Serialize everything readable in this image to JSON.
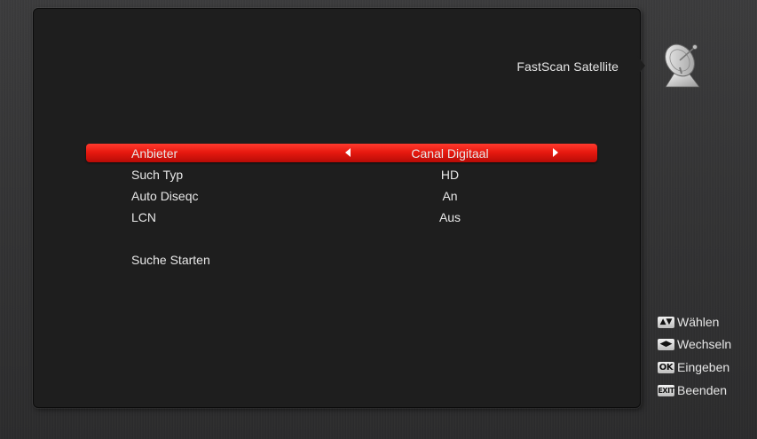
{
  "header": {
    "title": "FastScan Satellite",
    "icon": "satellite-dish-icon"
  },
  "menu": {
    "items": [
      {
        "label": "Anbieter",
        "value": "Canal Digitaal",
        "selected": true
      },
      {
        "label": "Such Typ",
        "value": "HD"
      },
      {
        "label": "Auto Diseqc",
        "value": "An"
      },
      {
        "label": "LCN",
        "value": "Aus"
      },
      {
        "label": "Suche Starten",
        "value": ""
      }
    ]
  },
  "legend": {
    "items": [
      {
        "key": "▲▼",
        "label": "Wählen",
        "icon": "up-down-key-icon"
      },
      {
        "key": "◀▶",
        "label": "Wechseln",
        "icon": "left-right-key-icon"
      },
      {
        "key": "OK",
        "label": "Eingeben",
        "icon": "ok-key-icon"
      },
      {
        "key": "EXIT",
        "label": "Beenden",
        "icon": "exit-key-icon"
      }
    ]
  },
  "colors": {
    "selection": "#e81a10",
    "panel": "#1e1e1e",
    "text": "#e8e8e8"
  }
}
